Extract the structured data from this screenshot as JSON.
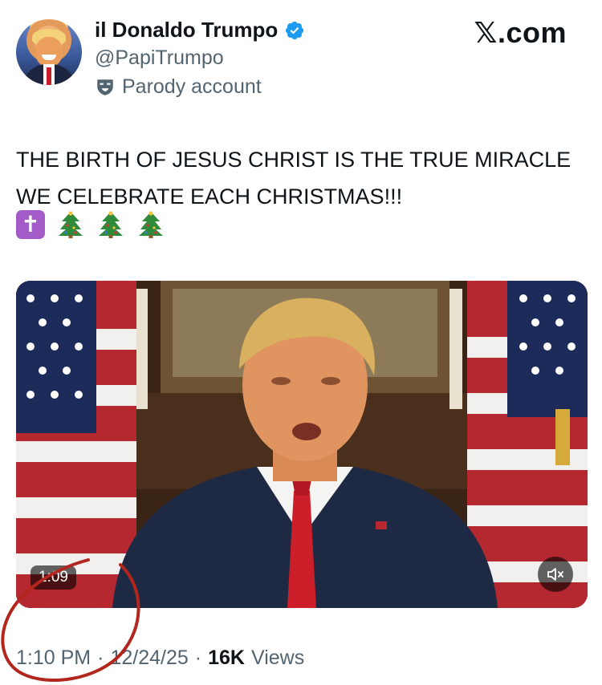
{
  "site_brand": "𝕏.com",
  "author": {
    "display_name": "il Donaldo Trumpo",
    "handle": "@PapiTrumpo",
    "label": "Parody account",
    "verified": true
  },
  "tweet": {
    "text": "THE BIRTH OF JESUS CHRIST IS THE TRUE MIRACLE WE CELEBRATE EACH CHRISTMAS!!!",
    "emojis": [
      "latin-cross-emoji",
      "christmas-tree-emoji",
      "christmas-tree-emoji",
      "christmas-tree-emoji"
    ]
  },
  "video": {
    "duration": "1:09",
    "muted": true
  },
  "meta": {
    "time": "1:10 PM",
    "separator": "·",
    "date": "12/24/25",
    "views_count": "16K",
    "views_label": "Views"
  },
  "colors": {
    "text": "#0f1419",
    "secondary": "#536471",
    "verified_blue": "#1d9bf0",
    "annotation_red": "#b3261e",
    "cross_purple": "#a25bc7"
  }
}
